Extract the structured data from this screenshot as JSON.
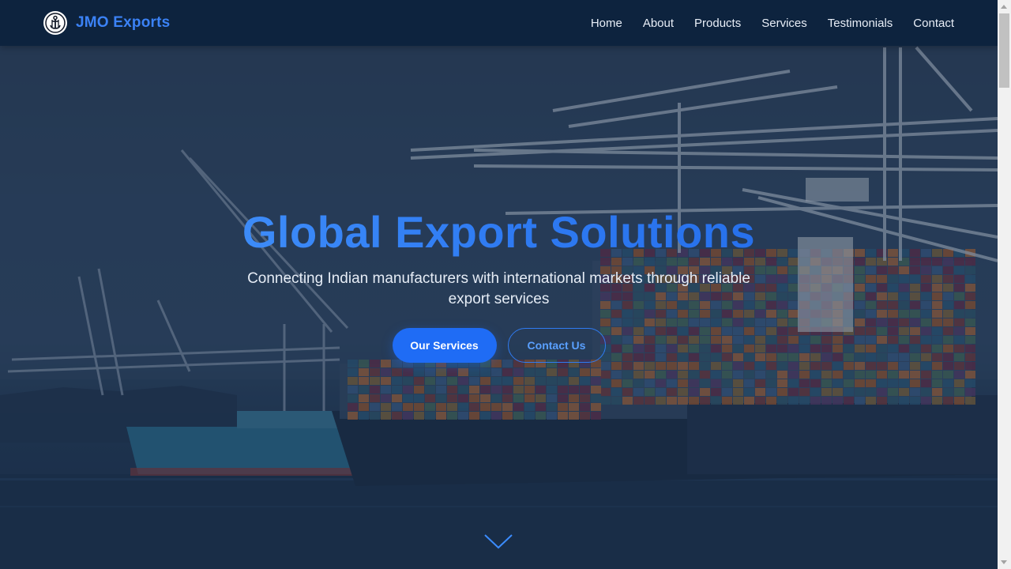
{
  "brand": {
    "name": "JMO Exports",
    "logo_icon": "anchor-logo-icon",
    "color": "#3b82f6"
  },
  "nav": {
    "items": [
      "Home",
      "About",
      "Products",
      "Services",
      "Testimonials",
      "Contact"
    ]
  },
  "hero": {
    "title": "Global Export Solutions",
    "subtitle": "Connecting Indian manufacturers with international markets through reliable export services",
    "primary_button": "Our Services",
    "secondary_button": "Contact Us",
    "scroll_icon": "chevron-down-icon",
    "background_image": "port-container-ship-cranes-photo"
  },
  "colors": {
    "navbar": "#0d223d",
    "accent": "#1f6cf5",
    "title_gradient_start": "#4a9bff",
    "title_gradient_end": "#1f66e6"
  }
}
